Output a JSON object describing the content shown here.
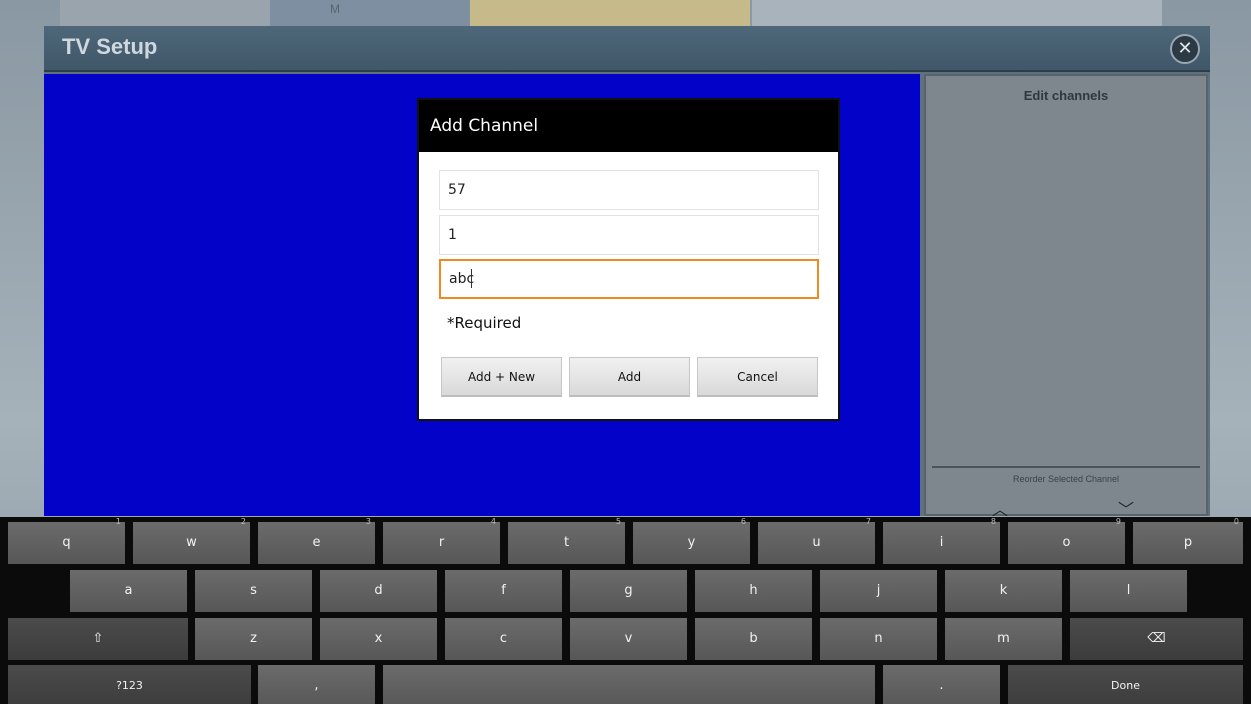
{
  "background_app": {
    "tab_texts": [
      "M",
      "",
      "",
      ""
    ]
  },
  "window": {
    "title": "TV Setup",
    "close_glyph": "✕"
  },
  "edit_panel": {
    "title": "Edit channels",
    "reorder_label": "Reorder Selected Channel",
    "up_glyph": "︿",
    "down_glyph": "﹀"
  },
  "dialog": {
    "title": "Add Channel",
    "fields": [
      {
        "value": "57"
      },
      {
        "value": "1"
      },
      {
        "value": "abc"
      }
    ],
    "required_note": "*Required",
    "buttons": {
      "add_new": "Add + New",
      "add": "Add",
      "cancel": "Cancel"
    }
  },
  "keyboard": {
    "row1": [
      {
        "label": "q",
        "hint": "1"
      },
      {
        "label": "w",
        "hint": "2"
      },
      {
        "label": "e",
        "hint": "3"
      },
      {
        "label": "r",
        "hint": "4"
      },
      {
        "label": "t",
        "hint": "5"
      },
      {
        "label": "y",
        "hint": "6"
      },
      {
        "label": "u",
        "hint": "7"
      },
      {
        "label": "i",
        "hint": "8"
      },
      {
        "label": "o",
        "hint": "9"
      },
      {
        "label": "p",
        "hint": "0"
      }
    ],
    "row2": [
      "a",
      "s",
      "d",
      "f",
      "g",
      "h",
      "j",
      "k",
      "l"
    ],
    "row3": [
      "z",
      "x",
      "c",
      "v",
      "b",
      "n",
      "m"
    ],
    "shift_glyph": "⇧",
    "backspace_glyph": "⌫",
    "symbols_label": "?123",
    "comma_label": ",",
    "period_label": ".",
    "done_label": "Done"
  }
}
